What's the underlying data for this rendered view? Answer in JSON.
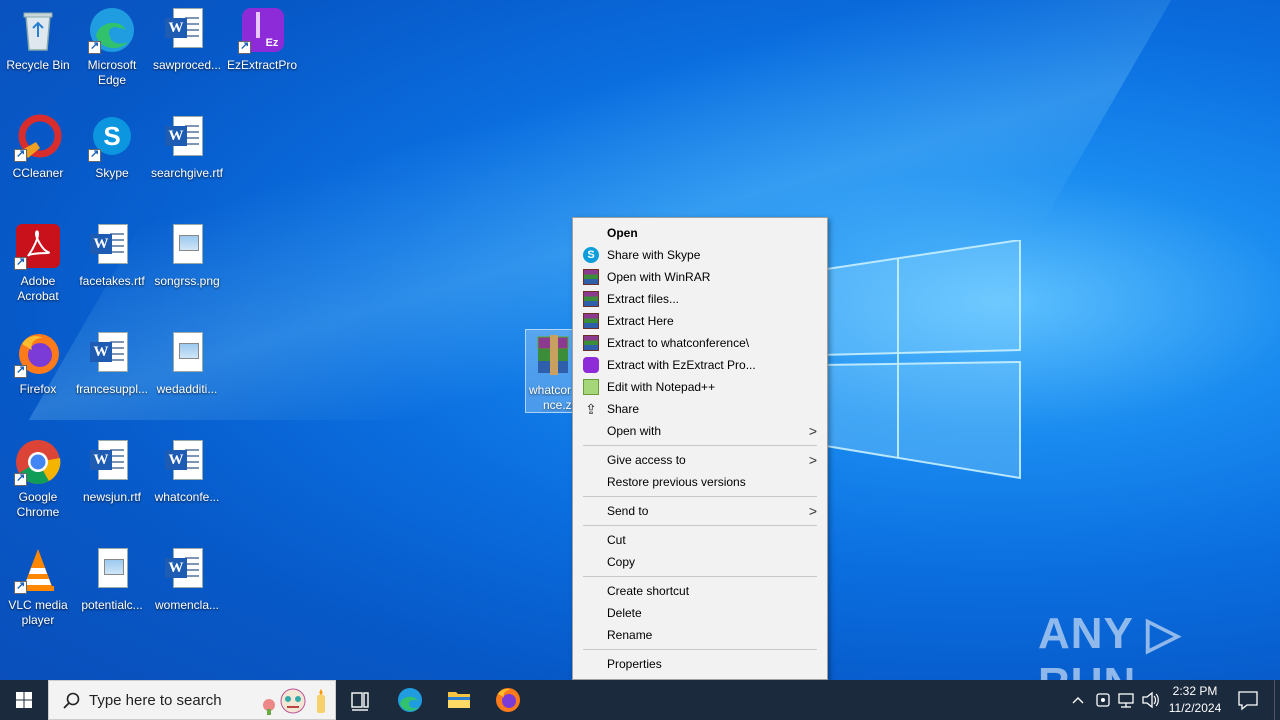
{
  "desktop": {
    "icons": [
      {
        "label": "Recycle Bin"
      },
      {
        "label": "Microsoft Edge"
      },
      {
        "label": "sawproced..."
      },
      {
        "label": "EzExtractPro"
      },
      {
        "label": "CCleaner"
      },
      {
        "label": "Skype"
      },
      {
        "label": "searchgive.rtf"
      },
      {
        "label": "Adobe Acrobat"
      },
      {
        "label": "facetakes.rtf"
      },
      {
        "label": "songrss.png"
      },
      {
        "label": "Firefox"
      },
      {
        "label": "francesuppl..."
      },
      {
        "label": "wedadditi..."
      },
      {
        "label": "Google Chrome"
      },
      {
        "label": "newsjun.rtf"
      },
      {
        "label": "whatconfe..."
      },
      {
        "label": "VLC media player"
      },
      {
        "label": "potentialc..."
      },
      {
        "label": "womencla..."
      }
    ],
    "selected_file": {
      "label": "whatconference.zip",
      "visible_label_line1": "whatcor",
      "visible_label_line2": "nce.zi"
    }
  },
  "context_menu": {
    "items": [
      {
        "label": "Open",
        "icon": "none",
        "bold": true
      },
      {
        "label": "Share with Skype",
        "icon": "skype-icon"
      },
      {
        "label": "Open with WinRAR",
        "icon": "winrar-icon"
      },
      {
        "label": "Extract files...",
        "icon": "winrar-icon"
      },
      {
        "label": "Extract Here",
        "icon": "winrar-icon"
      },
      {
        "label": "Extract to whatconference\\",
        "icon": "winrar-icon"
      },
      {
        "label": "Extract with EzExtract Pro...",
        "icon": "ezextract-icon"
      },
      {
        "label": "Edit with Notepad++",
        "icon": "notepadpp-icon"
      },
      {
        "label": "Share",
        "icon": "share-icon"
      },
      {
        "label": "Open with",
        "submenu": true
      },
      {
        "label": "Give access to",
        "submenu": true
      },
      {
        "label": "Restore previous versions"
      },
      {
        "label": "Send to",
        "submenu": true
      },
      {
        "label": "Cut"
      },
      {
        "label": "Copy"
      },
      {
        "label": "Create shortcut"
      },
      {
        "label": "Delete"
      },
      {
        "label": "Rename"
      },
      {
        "label": "Properties"
      }
    ],
    "submenu_arrow": ">"
  },
  "taskbar": {
    "search_placeholder": "Type here to search",
    "time": "2:32 PM",
    "date": "11/2/2024"
  },
  "watermark": {
    "text": "ANY ▷ RUN"
  }
}
